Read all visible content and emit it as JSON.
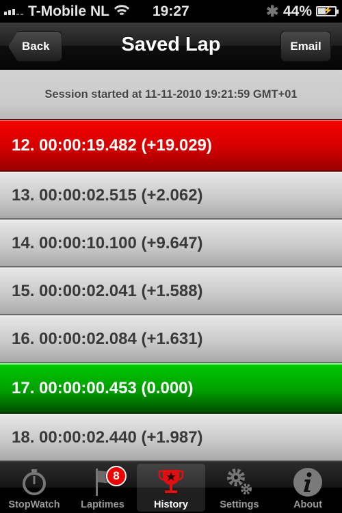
{
  "status_bar": {
    "carrier": "T-Mobile NL",
    "time": "19:27",
    "battery_percent_label": "44%",
    "battery_level": 0.44
  },
  "nav": {
    "title": "Saved Lap",
    "back_label": "Back",
    "email_label": "Email"
  },
  "session": {
    "text": "Session started at 11-11-2010 19:21:59 GMT+01"
  },
  "laps": [
    {
      "text": "12. 00:00:19.482 (+19.029)",
      "status": "worst"
    },
    {
      "text": "13. 00:00:02.515 (+2.062)",
      "status": "normal"
    },
    {
      "text": "14. 00:00:10.100 (+9.647)",
      "status": "normal"
    },
    {
      "text": "15. 00:00:02.041 (+1.588)",
      "status": "normal"
    },
    {
      "text": "16. 00:00:02.084 (+1.631)",
      "status": "normal"
    },
    {
      "text": "17. 00:00:00.453 (0.000)",
      "status": "best"
    },
    {
      "text": "18. 00:00:02.440 (+1.987)",
      "status": "normal"
    }
  ],
  "tabbar": {
    "tabs": [
      {
        "label": "StopWatch",
        "icon": "stopwatch-icon"
      },
      {
        "label": "Laptimes",
        "icon": "flag-icon",
        "badge": "8"
      },
      {
        "label": "History",
        "icon": "trophy-icon",
        "active": true
      },
      {
        "label": "Settings",
        "icon": "gears-icon"
      },
      {
        "label": "About",
        "icon": "info-icon"
      }
    ]
  },
  "colors": {
    "worst": "#d20000",
    "best": "#009e00",
    "active_tab_icon": "#e01010"
  }
}
